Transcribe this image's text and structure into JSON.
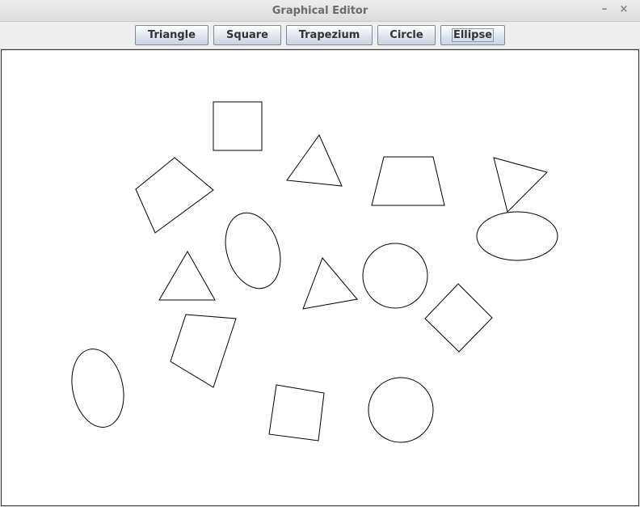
{
  "window": {
    "title": "Graphical Editor",
    "minimize_glyph": "–",
    "close_glyph": "×"
  },
  "toolbar": {
    "buttons": [
      {
        "label": "Triangle"
      },
      {
        "label": "Square"
      },
      {
        "label": "Trapezium"
      },
      {
        "label": "Circle"
      },
      {
        "label": "Ellipse",
        "focused": true
      }
    ]
  },
  "canvas": {
    "background": "#ffffff",
    "stroke_color": "#000000",
    "shape_kinds": [
      "square",
      "triangle",
      "trapezium",
      "quadrilateral",
      "ellipse",
      "circle"
    ]
  }
}
